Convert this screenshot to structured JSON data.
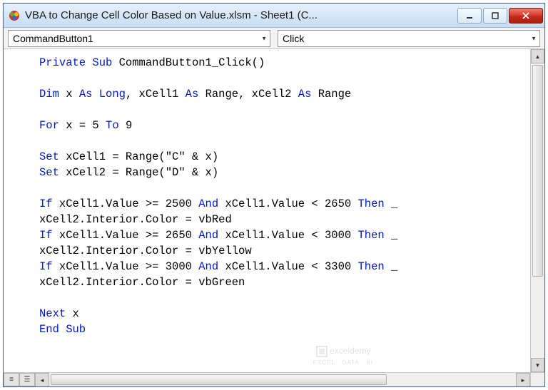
{
  "window": {
    "title": "VBA to Change Cell Color Based on Value.xlsm - Sheet1 (C..."
  },
  "toolbar": {
    "object_combo": "CommandButton1",
    "procedure_combo": "Click"
  },
  "code": {
    "lines": [
      {
        "t": [
          {
            "k": true,
            "s": "Private Sub"
          },
          {
            "k": false,
            "s": " CommandButton1_Click()"
          }
        ]
      },
      {
        "t": [
          {
            "k": false,
            "s": ""
          }
        ]
      },
      {
        "t": [
          {
            "k": true,
            "s": "Dim"
          },
          {
            "k": false,
            "s": " x "
          },
          {
            "k": true,
            "s": "As Long"
          },
          {
            "k": false,
            "s": ", xCell1 "
          },
          {
            "k": true,
            "s": "As"
          },
          {
            "k": false,
            "s": " Range, xCell2 "
          },
          {
            "k": true,
            "s": "As"
          },
          {
            "k": false,
            "s": " Range"
          }
        ]
      },
      {
        "t": [
          {
            "k": false,
            "s": ""
          }
        ]
      },
      {
        "t": [
          {
            "k": true,
            "s": "For"
          },
          {
            "k": false,
            "s": " x = 5 "
          },
          {
            "k": true,
            "s": "To"
          },
          {
            "k": false,
            "s": " 9"
          }
        ]
      },
      {
        "t": [
          {
            "k": false,
            "s": ""
          }
        ]
      },
      {
        "t": [
          {
            "k": true,
            "s": "Set"
          },
          {
            "k": false,
            "s": " xCell1 = Range(\"C\" & x)"
          }
        ]
      },
      {
        "t": [
          {
            "k": true,
            "s": "Set"
          },
          {
            "k": false,
            "s": " xCell2 = Range(\"D\" & x)"
          }
        ]
      },
      {
        "t": [
          {
            "k": false,
            "s": ""
          }
        ]
      },
      {
        "t": [
          {
            "k": true,
            "s": "If"
          },
          {
            "k": false,
            "s": " xCell1.Value >= 2500 "
          },
          {
            "k": true,
            "s": "And"
          },
          {
            "k": false,
            "s": " xCell1.Value < 2650 "
          },
          {
            "k": true,
            "s": "Then"
          },
          {
            "k": false,
            "s": " _"
          }
        ]
      },
      {
        "t": [
          {
            "k": false,
            "s": "xCell2.Interior.Color = vbRed"
          }
        ]
      },
      {
        "t": [
          {
            "k": true,
            "s": "If"
          },
          {
            "k": false,
            "s": " xCell1.Value >= 2650 "
          },
          {
            "k": true,
            "s": "And"
          },
          {
            "k": false,
            "s": " xCell1.Value < 3000 "
          },
          {
            "k": true,
            "s": "Then"
          },
          {
            "k": false,
            "s": " _"
          }
        ]
      },
      {
        "t": [
          {
            "k": false,
            "s": "xCell2.Interior.Color = vbYellow"
          }
        ]
      },
      {
        "t": [
          {
            "k": true,
            "s": "If"
          },
          {
            "k": false,
            "s": " xCell1.Value >= 3000 "
          },
          {
            "k": true,
            "s": "And"
          },
          {
            "k": false,
            "s": " xCell1.Value < 3300 "
          },
          {
            "k": true,
            "s": "Then"
          },
          {
            "k": false,
            "s": " _"
          }
        ]
      },
      {
        "t": [
          {
            "k": false,
            "s": "xCell2.Interior.Color = vbGreen"
          }
        ]
      },
      {
        "t": [
          {
            "k": false,
            "s": ""
          }
        ]
      },
      {
        "t": [
          {
            "k": true,
            "s": "Next"
          },
          {
            "k": false,
            "s": " x"
          }
        ]
      },
      {
        "t": [
          {
            "k": true,
            "s": "End Sub"
          }
        ]
      }
    ]
  },
  "watermark": {
    "name": "exceldemy",
    "sub": "EXCEL · DATA · BI"
  }
}
